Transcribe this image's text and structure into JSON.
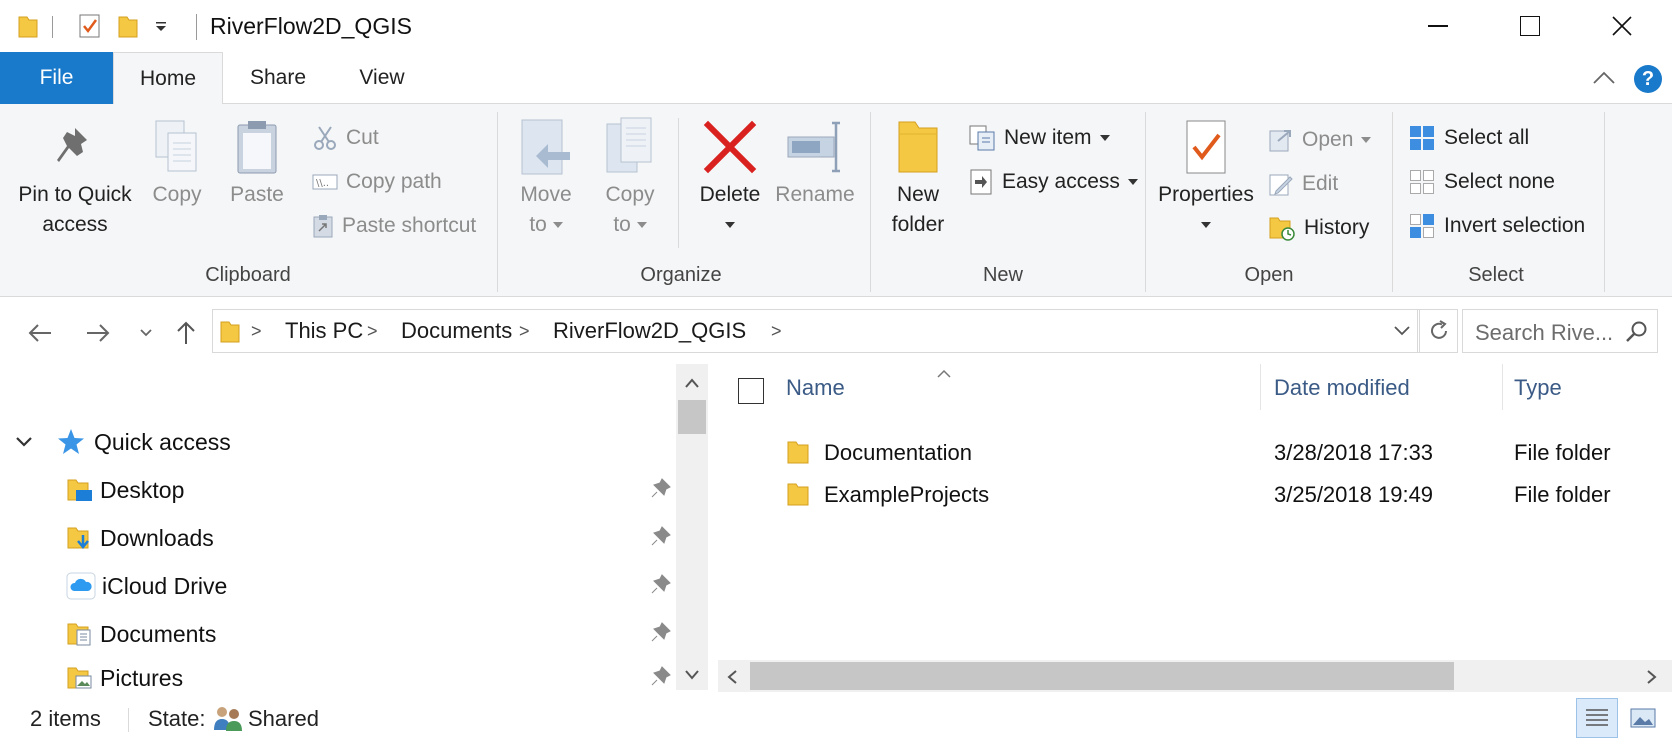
{
  "window": {
    "title": "RiverFlow2D_QGIS",
    "minimize_glyph": "—",
    "maximize_glyph": "☐",
    "close_glyph": "✕"
  },
  "tabs": [
    {
      "label": "File"
    },
    {
      "label": "Home"
    },
    {
      "label": "Share"
    },
    {
      "label": "View"
    }
  ],
  "ribbon": {
    "clipboard": {
      "label": "Clipboard",
      "pin_line1": "Pin to Quick",
      "pin_line2": "access",
      "copy": "Copy",
      "paste": "Paste",
      "cut": "Cut",
      "copy_path": "Copy path",
      "paste_shortcut": "Paste shortcut"
    },
    "organize": {
      "label": "Organize",
      "move_line1": "Move",
      "move_line2": "to",
      "copy_line1": "Copy",
      "copy_line2": "to",
      "delete": "Delete",
      "rename": "Rename"
    },
    "new": {
      "label": "New",
      "new_folder_line1": "New",
      "new_folder_line2": "folder",
      "new_item": "New item",
      "easy_access": "Easy access"
    },
    "open": {
      "label": "Open",
      "properties": "Properties",
      "open": "Open",
      "edit": "Edit",
      "history": "History"
    },
    "select": {
      "label": "Select",
      "select_all": "Select all",
      "select_none": "Select none",
      "invert_selection": "Invert selection"
    }
  },
  "address": {
    "crumbs": [
      "This PC",
      "Documents",
      "RiverFlow2D_QGIS"
    ],
    "search_placeholder": "Search Rive..."
  },
  "nav": {
    "quick_access": "Quick access",
    "items": [
      {
        "label": "Desktop",
        "icon": "desktop-folder-icon"
      },
      {
        "label": "Downloads",
        "icon": "downloads-folder-icon"
      },
      {
        "label": "iCloud Drive",
        "icon": "icloud-icon"
      },
      {
        "label": "Documents",
        "icon": "documents-folder-icon"
      },
      {
        "label": "Pictures",
        "icon": "pictures-folder-icon"
      }
    ]
  },
  "list": {
    "columns": {
      "name": "Name",
      "date": "Date modified",
      "type": "Type"
    },
    "rows": [
      {
        "name": "Documentation",
        "date": "3/28/2018 17:33",
        "type": "File folder"
      },
      {
        "name": "ExampleProjects",
        "date": "3/25/2018 19:49",
        "type": "File folder"
      }
    ]
  },
  "status": {
    "count": "2 items",
    "state_label": "State:",
    "state_value": "Shared"
  },
  "colors": {
    "file_tab": "#1979ca",
    "folder_yellow": "#f4c842",
    "delete_red": "#d9211f",
    "column_header": "#3b5b86"
  }
}
